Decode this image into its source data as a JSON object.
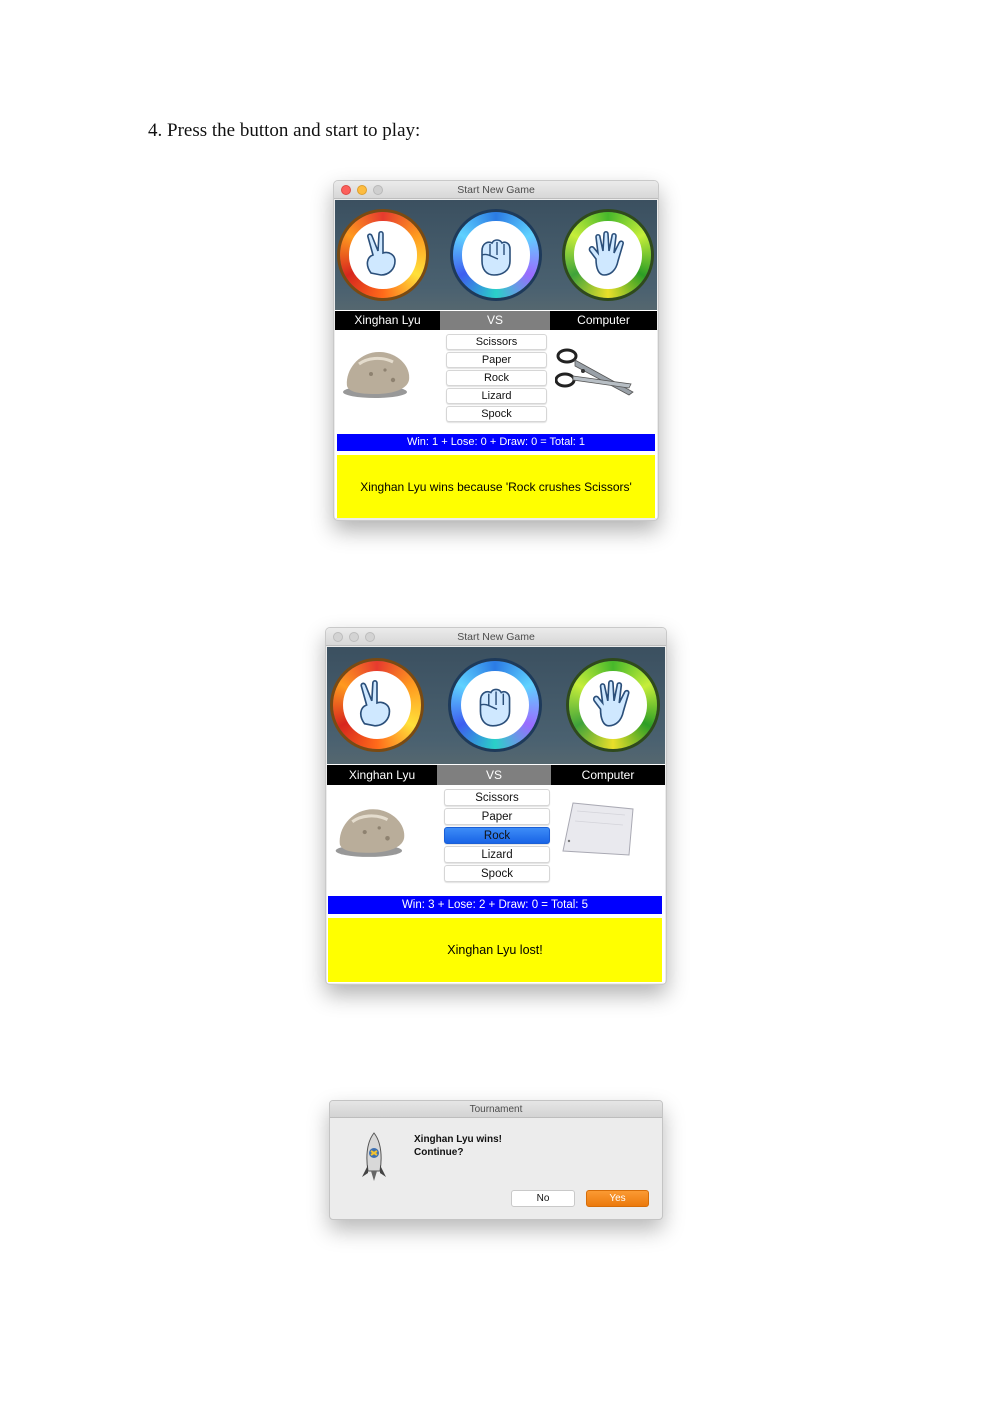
{
  "document": {
    "heading": "4. Press the button and start to play:"
  },
  "window1": {
    "title": "Start New Game",
    "player_label": "Xinghan Lyu",
    "vs_label": "VS",
    "opponent_label": "Computer",
    "choices": [
      "Scissors",
      "Paper",
      "Rock",
      "Lizard",
      "Spock"
    ],
    "selected_choice": null,
    "player_pick_image": "rock",
    "computer_pick_image": "scissors",
    "score": "Win: 1 + Lose: 0 + Draw: 0 = Total: 1",
    "result": "Xinghan Lyu wins because 'Rock crushes Scissors'"
  },
  "window2": {
    "title": "Start New Game",
    "player_label": "Xinghan Lyu",
    "vs_label": "VS",
    "opponent_label": "Computer",
    "choices": [
      "Scissors",
      "Paper",
      "Rock",
      "Lizard",
      "Spock"
    ],
    "selected_choice": "Rock",
    "player_pick_image": "rock",
    "computer_pick_image": "paper",
    "score": "Win: 3 + Lose: 2 + Draw: 0 = Total: 5",
    "result": "Xinghan Lyu lost!"
  },
  "dialog": {
    "title": "Tournament",
    "message_line1": "Xinghan Lyu wins!",
    "message_line2": "Continue?",
    "no_label": "No",
    "yes_label": "Yes"
  },
  "colors": {
    "score_bar": "#0000ff",
    "result_panel": "#ffff00",
    "banner": "#4a6170",
    "selected_choice": "#1f6ef0",
    "yes_button": "#f0820f"
  },
  "icons": {
    "banner": [
      "scissors-hand-icon",
      "rock-fist-icon",
      "paper-hand-icon"
    ],
    "dialog": "python-rocket-icon"
  }
}
